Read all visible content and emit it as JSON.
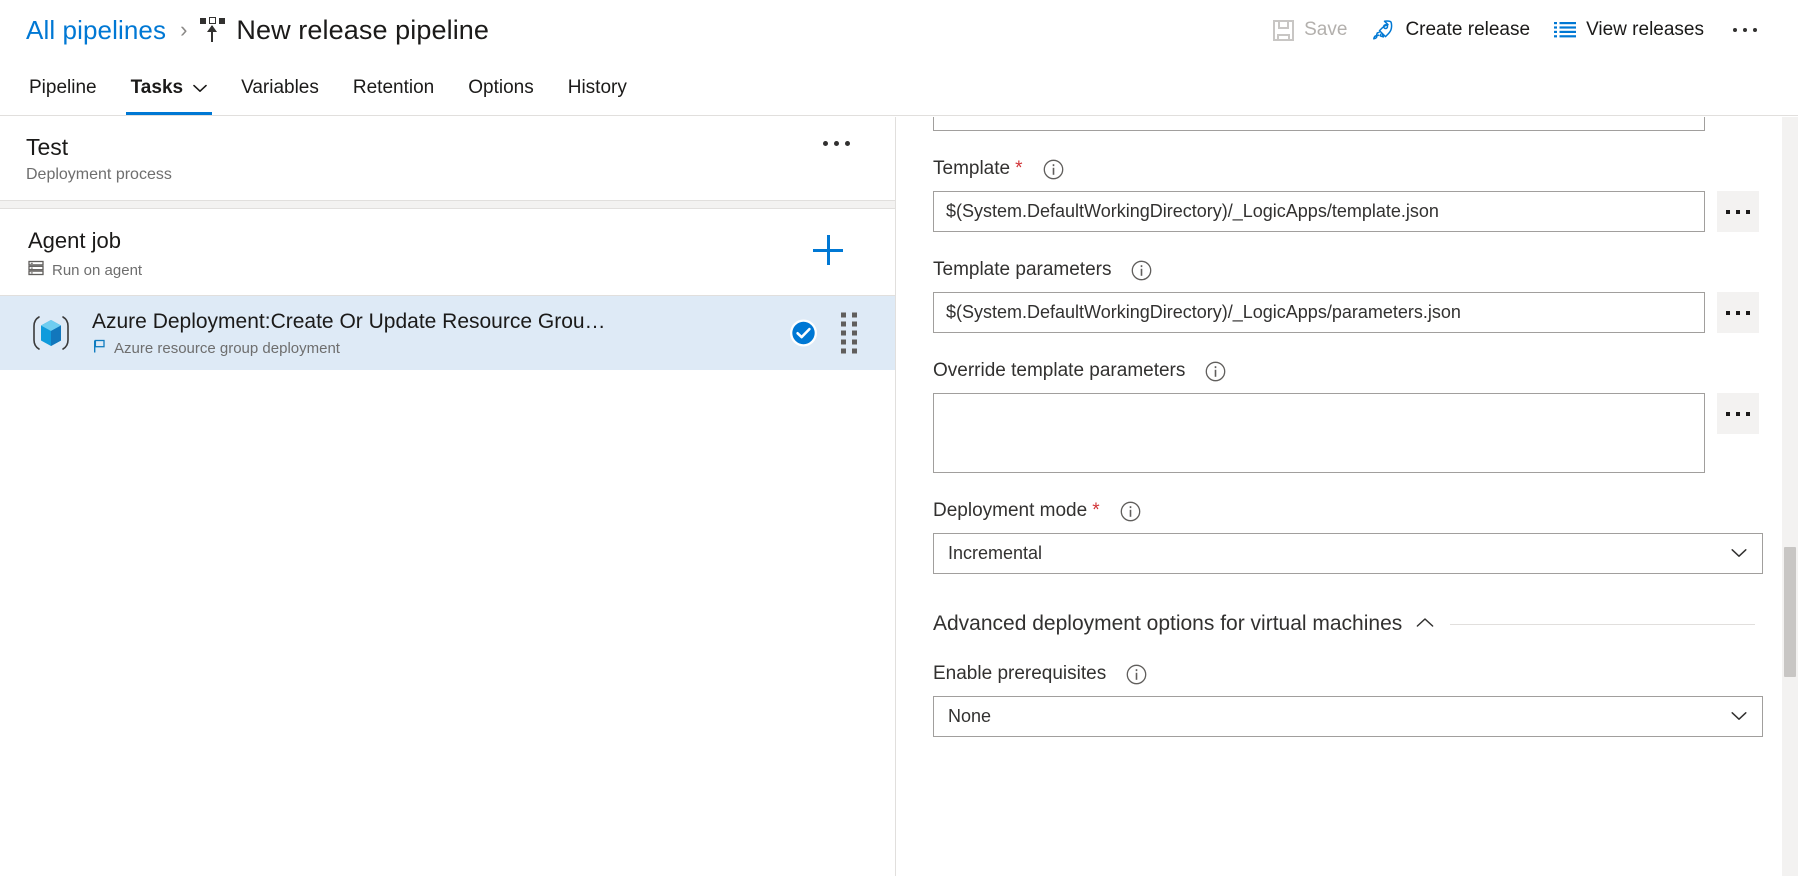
{
  "breadcrumb": {
    "root_label": "All pipelines",
    "separator": "›",
    "current_label": "New release pipeline",
    "pipeline_icon": "pipeline-icon"
  },
  "toolbar": {
    "save_label": "Save",
    "save_icon": "floppy-disk-icon",
    "save_disabled": true,
    "create_release_label": "Create release",
    "create_release_icon": "rocket-icon",
    "view_releases_label": "View releases",
    "view_releases_icon": "list-icon",
    "more_icon": "ellipsis-icon"
  },
  "tabs": [
    {
      "label": "Pipeline",
      "active": false,
      "has_chevron": false
    },
    {
      "label": "Tasks",
      "active": true,
      "has_chevron": true
    },
    {
      "label": "Variables",
      "active": false,
      "has_chevron": false
    },
    {
      "label": "Retention",
      "active": false,
      "has_chevron": false
    },
    {
      "label": "Options",
      "active": false,
      "has_chevron": false
    },
    {
      "label": "History",
      "active": false,
      "has_chevron": false
    }
  ],
  "left_pane": {
    "header": {
      "title": "Test",
      "subtitle": "Deployment process",
      "more_icon": "ellipsis-icon"
    },
    "job": {
      "title": "Agent job",
      "subtitle": "Run on agent",
      "agent_icon": "agent-server-icon",
      "add_icon": "plus-icon"
    },
    "task": {
      "title": "Azure Deployment:Create Or Update Resource Grou…",
      "subtitle": "Azure resource group deployment",
      "task_icon": "azure-cube-icon",
      "flag_icon": "flag-icon",
      "status_icon": "check-circle-icon",
      "drag_icon": "drag-handle-icon",
      "selected": true
    }
  },
  "right_pane": {
    "fields": [
      {
        "label": "Template",
        "required": true,
        "info_icon": "info-icon",
        "control": "text",
        "value": "$(System.DefaultWorkingDirectory)/_LogicApps/template.json",
        "browse_label": "…",
        "browse_icon": "ellipsis-icon"
      },
      {
        "label": "Template parameters",
        "required": false,
        "info_icon": "info-icon",
        "control": "text",
        "value": "$(System.DefaultWorkingDirectory)/_LogicApps/parameters.json",
        "browse_label": "…",
        "browse_icon": "ellipsis-icon"
      },
      {
        "label": "Override template parameters",
        "required": false,
        "info_icon": "info-icon",
        "control": "textarea",
        "value": "",
        "browse_label": "…",
        "browse_icon": "ellipsis-icon"
      },
      {
        "label": "Deployment mode",
        "required": true,
        "info_icon": "info-icon",
        "control": "select",
        "value": "Incremental",
        "chevron_icon": "chevron-down-icon"
      }
    ],
    "advanced_section": {
      "title": "Advanced deployment options for virtual machines",
      "expanded": true,
      "chevron_icon": "chevron-up-icon",
      "fields": [
        {
          "label": "Enable prerequisites",
          "required": false,
          "info_icon": "info-icon",
          "control": "select",
          "value": "None",
          "chevron_icon": "chevron-down-icon"
        }
      ]
    }
  },
  "colors": {
    "accent": "#0078d4",
    "selected_row": "#deeaf6",
    "required_star": "#d13438",
    "border": "#a19f9d",
    "divider": "#e1dfdd",
    "muted_text": "#6e6e6e",
    "disabled_text": "#b3b0ad"
  }
}
